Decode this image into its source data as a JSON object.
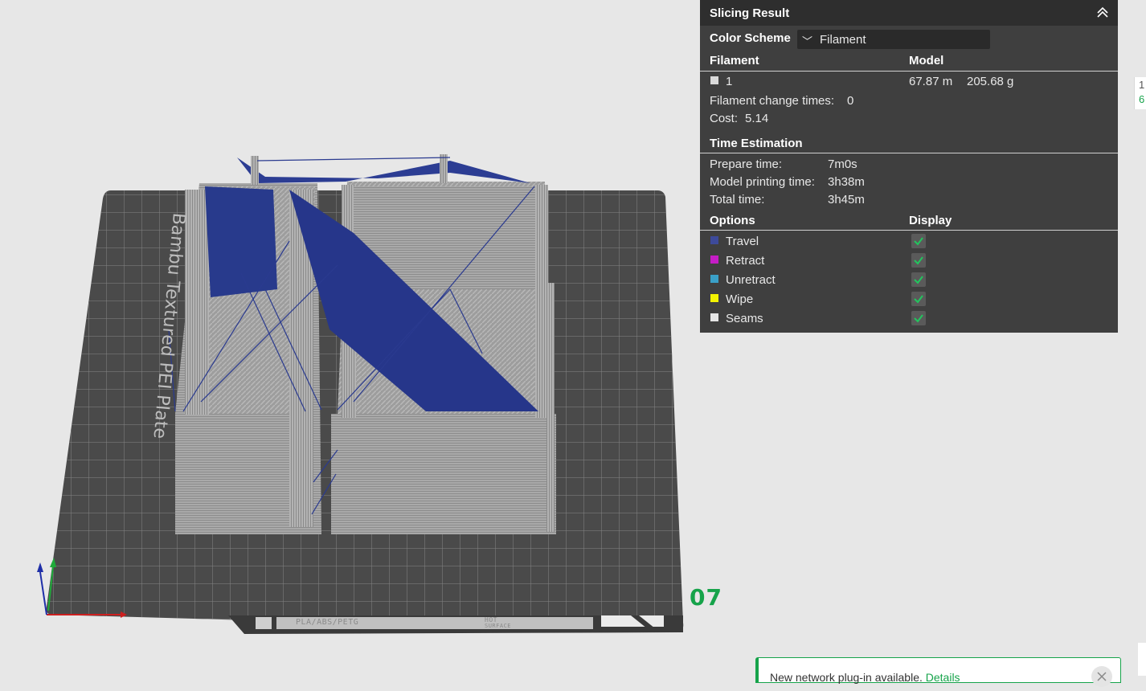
{
  "viewport": {
    "plate_label": "Bambu Textured PEI Plate",
    "plate_number": "07",
    "strip_material_text": "PLA/ABS/PETG",
    "strip_hot_text": "HOT",
    "strip_surface_text": "SURFACE"
  },
  "panel": {
    "title": "Slicing Result",
    "color_scheme_label": "Color Scheme",
    "color_scheme_value": "Filament",
    "filament_header": "Filament",
    "model_header": "Model",
    "filament_row": {
      "id": "1",
      "length": "67.87 m",
      "weight": "205.68 g",
      "swatch_color": "#d9d9d9"
    },
    "change_times_label": "Filament change times:",
    "change_times_value": "0",
    "cost_label": "Cost:",
    "cost_value": "5.14",
    "time_header": "Time Estimation",
    "prepare_label": "Prepare time:",
    "prepare_value": "7m0s",
    "model_print_label": "Model printing time:",
    "model_print_value": "3h38m",
    "total_label": "Total time:",
    "total_value": "3h45m",
    "options_header": "Options",
    "display_header": "Display",
    "options": [
      {
        "label": "Travel",
        "color": "#3d4a9a",
        "checked": true
      },
      {
        "label": "Retract",
        "color": "#c51dc6",
        "checked": true
      },
      {
        "label": "Unretract",
        "color": "#3aa0c8",
        "checked": true
      },
      {
        "label": "Wipe",
        "color": "#f2f200",
        "checked": true
      },
      {
        "label": "Seams",
        "color": "#e6e6e6",
        "checked": true
      }
    ]
  },
  "edge_tab": {
    "top": "1",
    "bottom": "6"
  },
  "notification": {
    "message": "New network plug-in available.",
    "link": "Details"
  }
}
